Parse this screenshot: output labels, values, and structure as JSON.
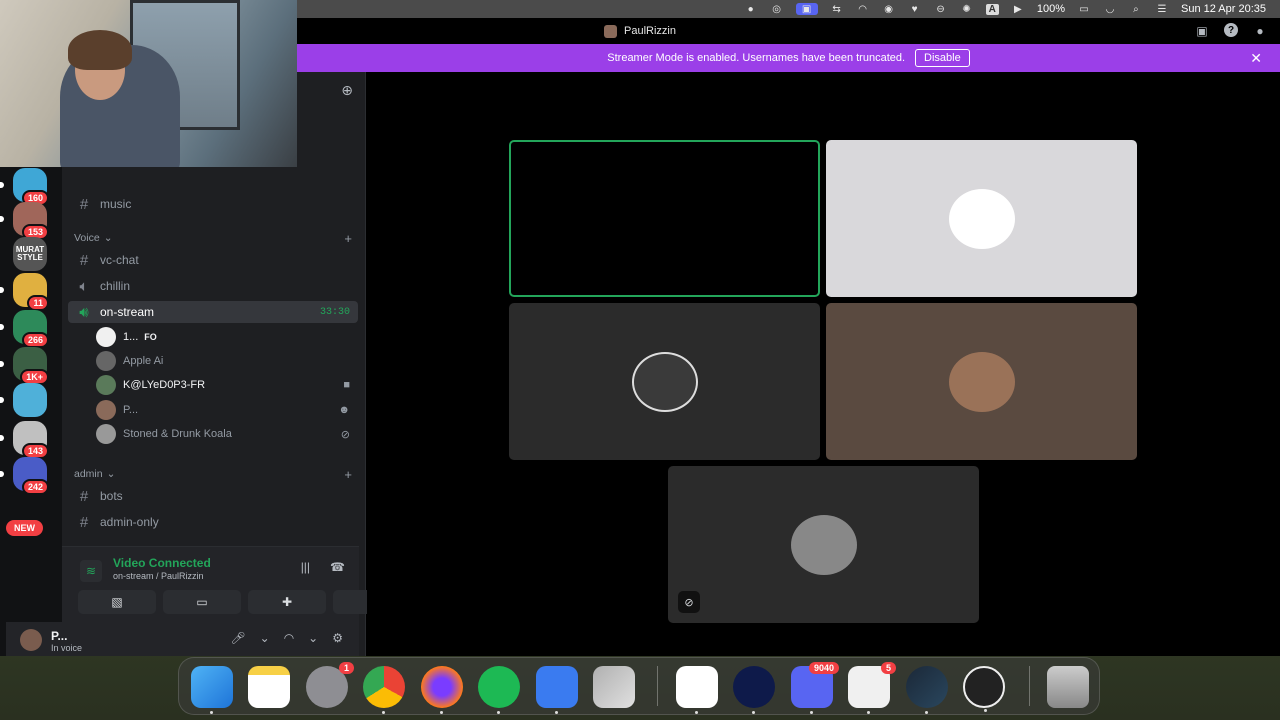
{
  "menubar": {
    "battery": "100%",
    "datetime": "Sun 12 Apr  20:35",
    "keyboard": "A"
  },
  "titlebar": {
    "title": "PaulRizzin"
  },
  "banner": {
    "text": "Streamer Mode is enabled. Usernames have been truncated.",
    "button": "Disable"
  },
  "servers": [
    {
      "badge": "160",
      "color": "#3fa7d6"
    },
    {
      "badge": "153",
      "color": "#a0665a"
    },
    {
      "badge": "",
      "color": "#555555",
      "label": "MURAT STYLE"
    },
    {
      "badge": "11",
      "color": "#e0b040"
    },
    {
      "badge": "266",
      "color": "#2d8a5a"
    },
    {
      "badge": "1K+",
      "color": "#3b5f44"
    },
    {
      "badge": "",
      "color": "#4fb0d9"
    },
    {
      "badge": "143",
      "color": "#c0c0c0"
    },
    {
      "badge": "242",
      "color": "#4a5cc7"
    }
  ],
  "new_badge": "NEW",
  "sidebar": {
    "channels_top": [
      {
        "name": "music"
      }
    ],
    "voice_category": "Voice",
    "voice_channels": [
      {
        "name": "vc-chat",
        "kind": "text"
      },
      {
        "name": "chillin",
        "kind": "voice"
      },
      {
        "name": "on-stream",
        "kind": "voice",
        "timer": "33:30"
      }
    ],
    "voice_users": [
      {
        "name": "1...",
        "tag": "FO"
      },
      {
        "name": "Apple Ai"
      },
      {
        "name": "K@LYeD0P3-FR"
      },
      {
        "name": "P..."
      },
      {
        "name": "Stoned & Drunk Koala"
      }
    ],
    "admin_category": "admin",
    "admin_channels": [
      {
        "name": "bots"
      },
      {
        "name": "admin-only"
      }
    ]
  },
  "voice_panel": {
    "title": "Video Connected",
    "subtitle": "on-stream / PaulRizzin"
  },
  "user_panel": {
    "name": "P...",
    "status": "In voice"
  },
  "dock": {
    "settings_badge": "1",
    "discord_badge": "9040",
    "store_badge": "5"
  }
}
